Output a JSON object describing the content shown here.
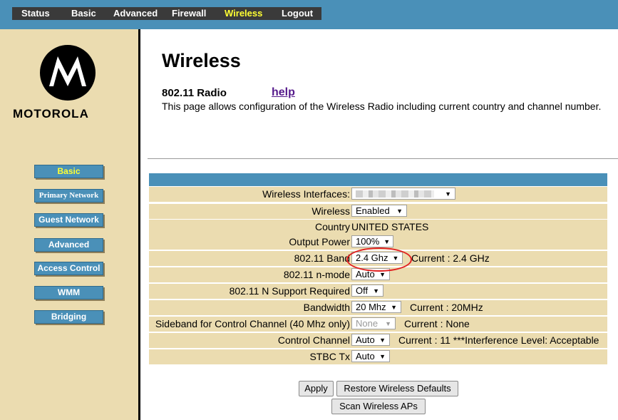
{
  "topnav": {
    "items": [
      "Status",
      "Basic",
      "Advanced",
      "Firewall",
      "Wireless",
      "Logout"
    ],
    "active": "Wireless"
  },
  "brand": {
    "logo_text": "MOTOROLA"
  },
  "sidebar": {
    "items": [
      "Basic",
      "Primary Network",
      "Guest Network",
      "Advanced",
      "Access Control",
      "WMM",
      "Bridging"
    ],
    "active": "Basic"
  },
  "page": {
    "title": "Wireless",
    "section_title": "802.11 Radio",
    "help_label": "help",
    "description": "This page allows configuration of the Wireless Radio including current country and channel number."
  },
  "form": {
    "wireless_interfaces": {
      "label": "Wireless Interfaces:",
      "value": ""
    },
    "wireless": {
      "label": "Wireless",
      "value": "Enabled"
    },
    "country": {
      "label": "Country",
      "value": "UNITED STATES"
    },
    "output_power": {
      "label": "Output Power",
      "value": "100%"
    },
    "band": {
      "label": "802.11 Band",
      "value": "2.4 Ghz",
      "current": "Current :  2.4 GHz"
    },
    "n_mode": {
      "label": "802.11 n-mode",
      "value": "Auto"
    },
    "n_support": {
      "label": "802.11 N Support Required",
      "value": "Off"
    },
    "bandwidth": {
      "label": "Bandwidth",
      "value": "20 Mhz",
      "current": "Current :  20MHz"
    },
    "sideband": {
      "label": "Sideband for Control Channel (40 Mhz only)",
      "value": "None",
      "current": "Current : None"
    },
    "control_channel": {
      "label": "Control Channel",
      "value": "Auto",
      "current": "Current :  11 ***Interference Level: Acceptable"
    },
    "stbc_tx": {
      "label": "STBC Tx",
      "value": "Auto"
    }
  },
  "buttons": {
    "apply": "Apply",
    "restore": "Restore Wireless Defaults",
    "scan": "Scan Wireless APs"
  },
  "colors": {
    "header_blue": "#4a90b8",
    "sidebar_tan": "#ebdcb0",
    "active_yellow": "#ffff33",
    "annotation_red": "#e02020"
  }
}
